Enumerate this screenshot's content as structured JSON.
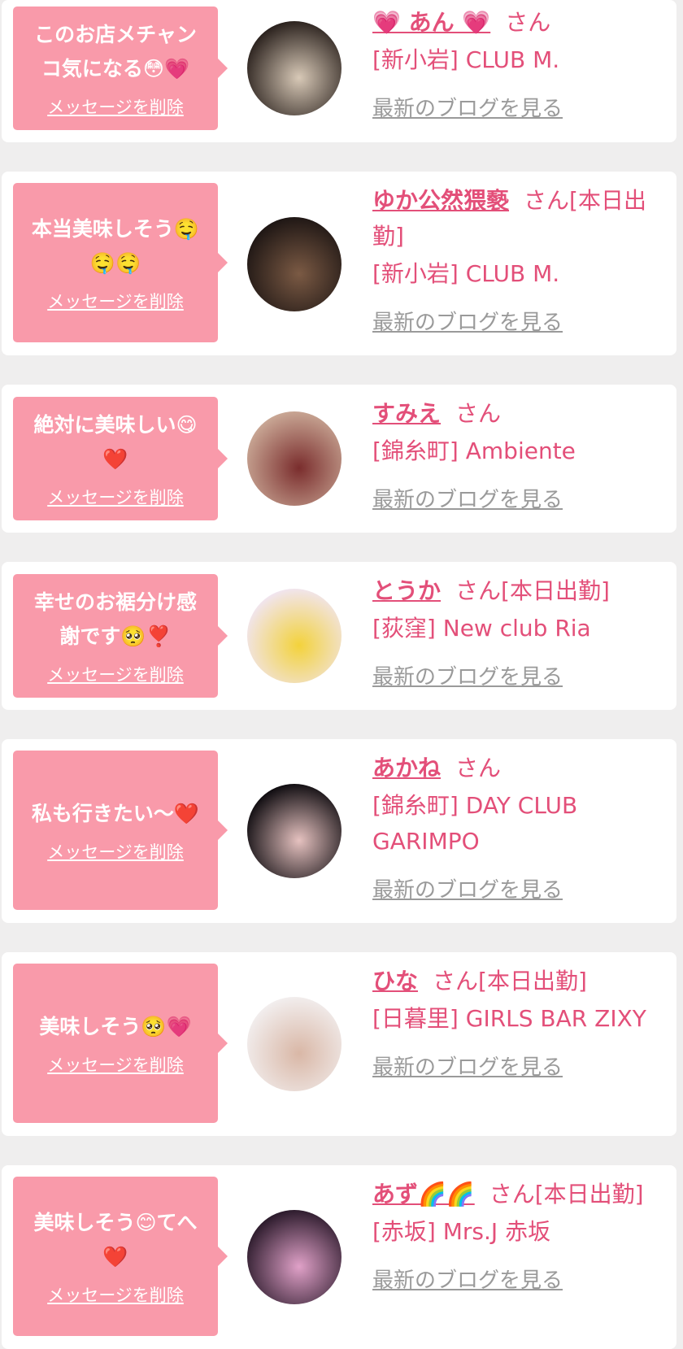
{
  "cards": [
    {
      "message": "このお店メチャン\nコ気になる😳💗",
      "delete_label": "メッセージを削除",
      "name": "💗 あん 💗",
      "honorific": "さん",
      "shop": "[新小岩] CLUB M.",
      "blog_label": "最新のブログを見る",
      "avatar_colors": [
        "#2a211d",
        "#d8c9b7"
      ]
    },
    {
      "message": "本当美味しそう🤤\n🤤🤤",
      "delete_label": "メッセージを削除",
      "name": "ゆか公然猥褻",
      "honorific": "さん[本日出勤]",
      "shop": "[新小岩] CLUB M.",
      "blog_label": "最新のブログを見る",
      "avatar_colors": [
        "#1e1614",
        "#7b5a44"
      ]
    },
    {
      "message": "絶対に美味しい😋\n❤️",
      "delete_label": "メッセージを削除",
      "name": "すみえ",
      "honorific": "さん",
      "shop": "[錦糸町] Ambiente",
      "blog_label": "最新のブログを見る",
      "avatar_colors": [
        "#c9a795",
        "#7a2d2d"
      ]
    },
    {
      "message": "幸せのお裾分け感\n謝です🥺❣️",
      "delete_label": "メッセージを削除",
      "name": "とうか",
      "honorific": "さん[本日出勤]",
      "shop": "[荻窪] New club Ria",
      "blog_label": "最新のブログを見る",
      "avatar_colors": [
        "#f1e5ef",
        "#f3d23b"
      ]
    },
    {
      "message": "私も行きたい〜❤️",
      "delete_label": "メッセージを削除",
      "name": "あかね",
      "honorific": "さん",
      "shop": "[錦糸町] DAY CLUB GARIMPO",
      "blog_label": "最新のブログを見る",
      "avatar_colors": [
        "#0f0c10",
        "#e6c2c0"
      ]
    },
    {
      "message": "美味しそう🥺💗",
      "delete_label": "メッセージを削除",
      "name": "ひな",
      "honorific": "さん[本日出勤]",
      "shop": "[日暮里] GIRLS BAR ZIXY",
      "blog_label": "最新のブログを見る",
      "avatar_colors": [
        "#f2eeee",
        "#d9b7a6"
      ]
    },
    {
      "message": "美味しそう😊てへ\n❤️",
      "delete_label": "メッセージを削除",
      "name": "あず🌈🌈",
      "honorific": "さん[本日出勤]",
      "shop": "[赤坂] Mrs.J 赤坂",
      "blog_label": "最新のブログを見る",
      "avatar_colors": [
        "#2b1a2b",
        "#e0a1c8"
      ]
    }
  ]
}
